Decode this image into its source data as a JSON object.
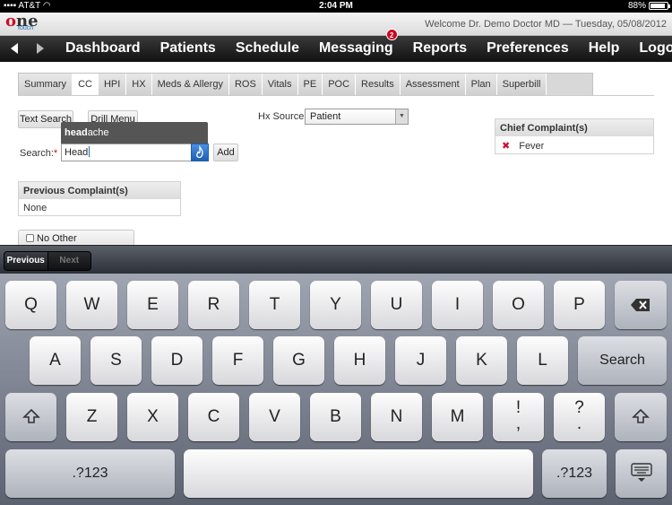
{
  "status": {
    "carrier": "AT&T",
    "time": "2:04 PM",
    "battery": "88%",
    "battery_level": 0.88
  },
  "header": {
    "logo_one": "ne",
    "logo_touch": "touch",
    "welcome": "Welcome Dr. Demo Doctor MD — Tuesday, 05/08/2012"
  },
  "nav": {
    "items": [
      "Dashboard",
      "Patients",
      "Schedule",
      "Messaging",
      "Reports",
      "Preferences",
      "Help",
      "Logout"
    ],
    "messaging_badge": "2"
  },
  "tabs": [
    "Summary",
    "CC",
    "HPI",
    "HX",
    "Meds & Allergy",
    "ROS",
    "Vitals",
    "PE",
    "POC",
    "Results",
    "Assessment",
    "Plan",
    "Superbill"
  ],
  "cc": {
    "text_search_btn": "Text Search",
    "drill_menu_btn": "Drill Menu",
    "search_label": "Search:",
    "required_mark": "*",
    "search_value": "Head",
    "suggest_bold": "head",
    "suggest_rest": "ache",
    "add_btn": "Add",
    "hx_source_label": "Hx Source:",
    "hx_source_value": "Patient",
    "chief_title": "Chief Complaint(s)",
    "chief_item": "Fever",
    "prev_title": "Previous Complaint(s)",
    "prev_value": "None",
    "no_other": "No Other Complaints?"
  },
  "kbtool": {
    "previous": "Previous",
    "next": "Next"
  },
  "keyboard": {
    "row1": [
      "Q",
      "W",
      "E",
      "R",
      "T",
      "Y",
      "U",
      "I",
      "O",
      "P"
    ],
    "row2": [
      "A",
      "S",
      "D",
      "F",
      "G",
      "H",
      "J",
      "K",
      "L"
    ],
    "row3": [
      "Z",
      "X",
      "C",
      "V",
      "B",
      "N",
      "M"
    ],
    "search": "Search",
    "excl_top": "!",
    "excl_bottom": ",",
    "q_top": "?",
    "q_bottom": ".",
    "num": ".?123"
  }
}
